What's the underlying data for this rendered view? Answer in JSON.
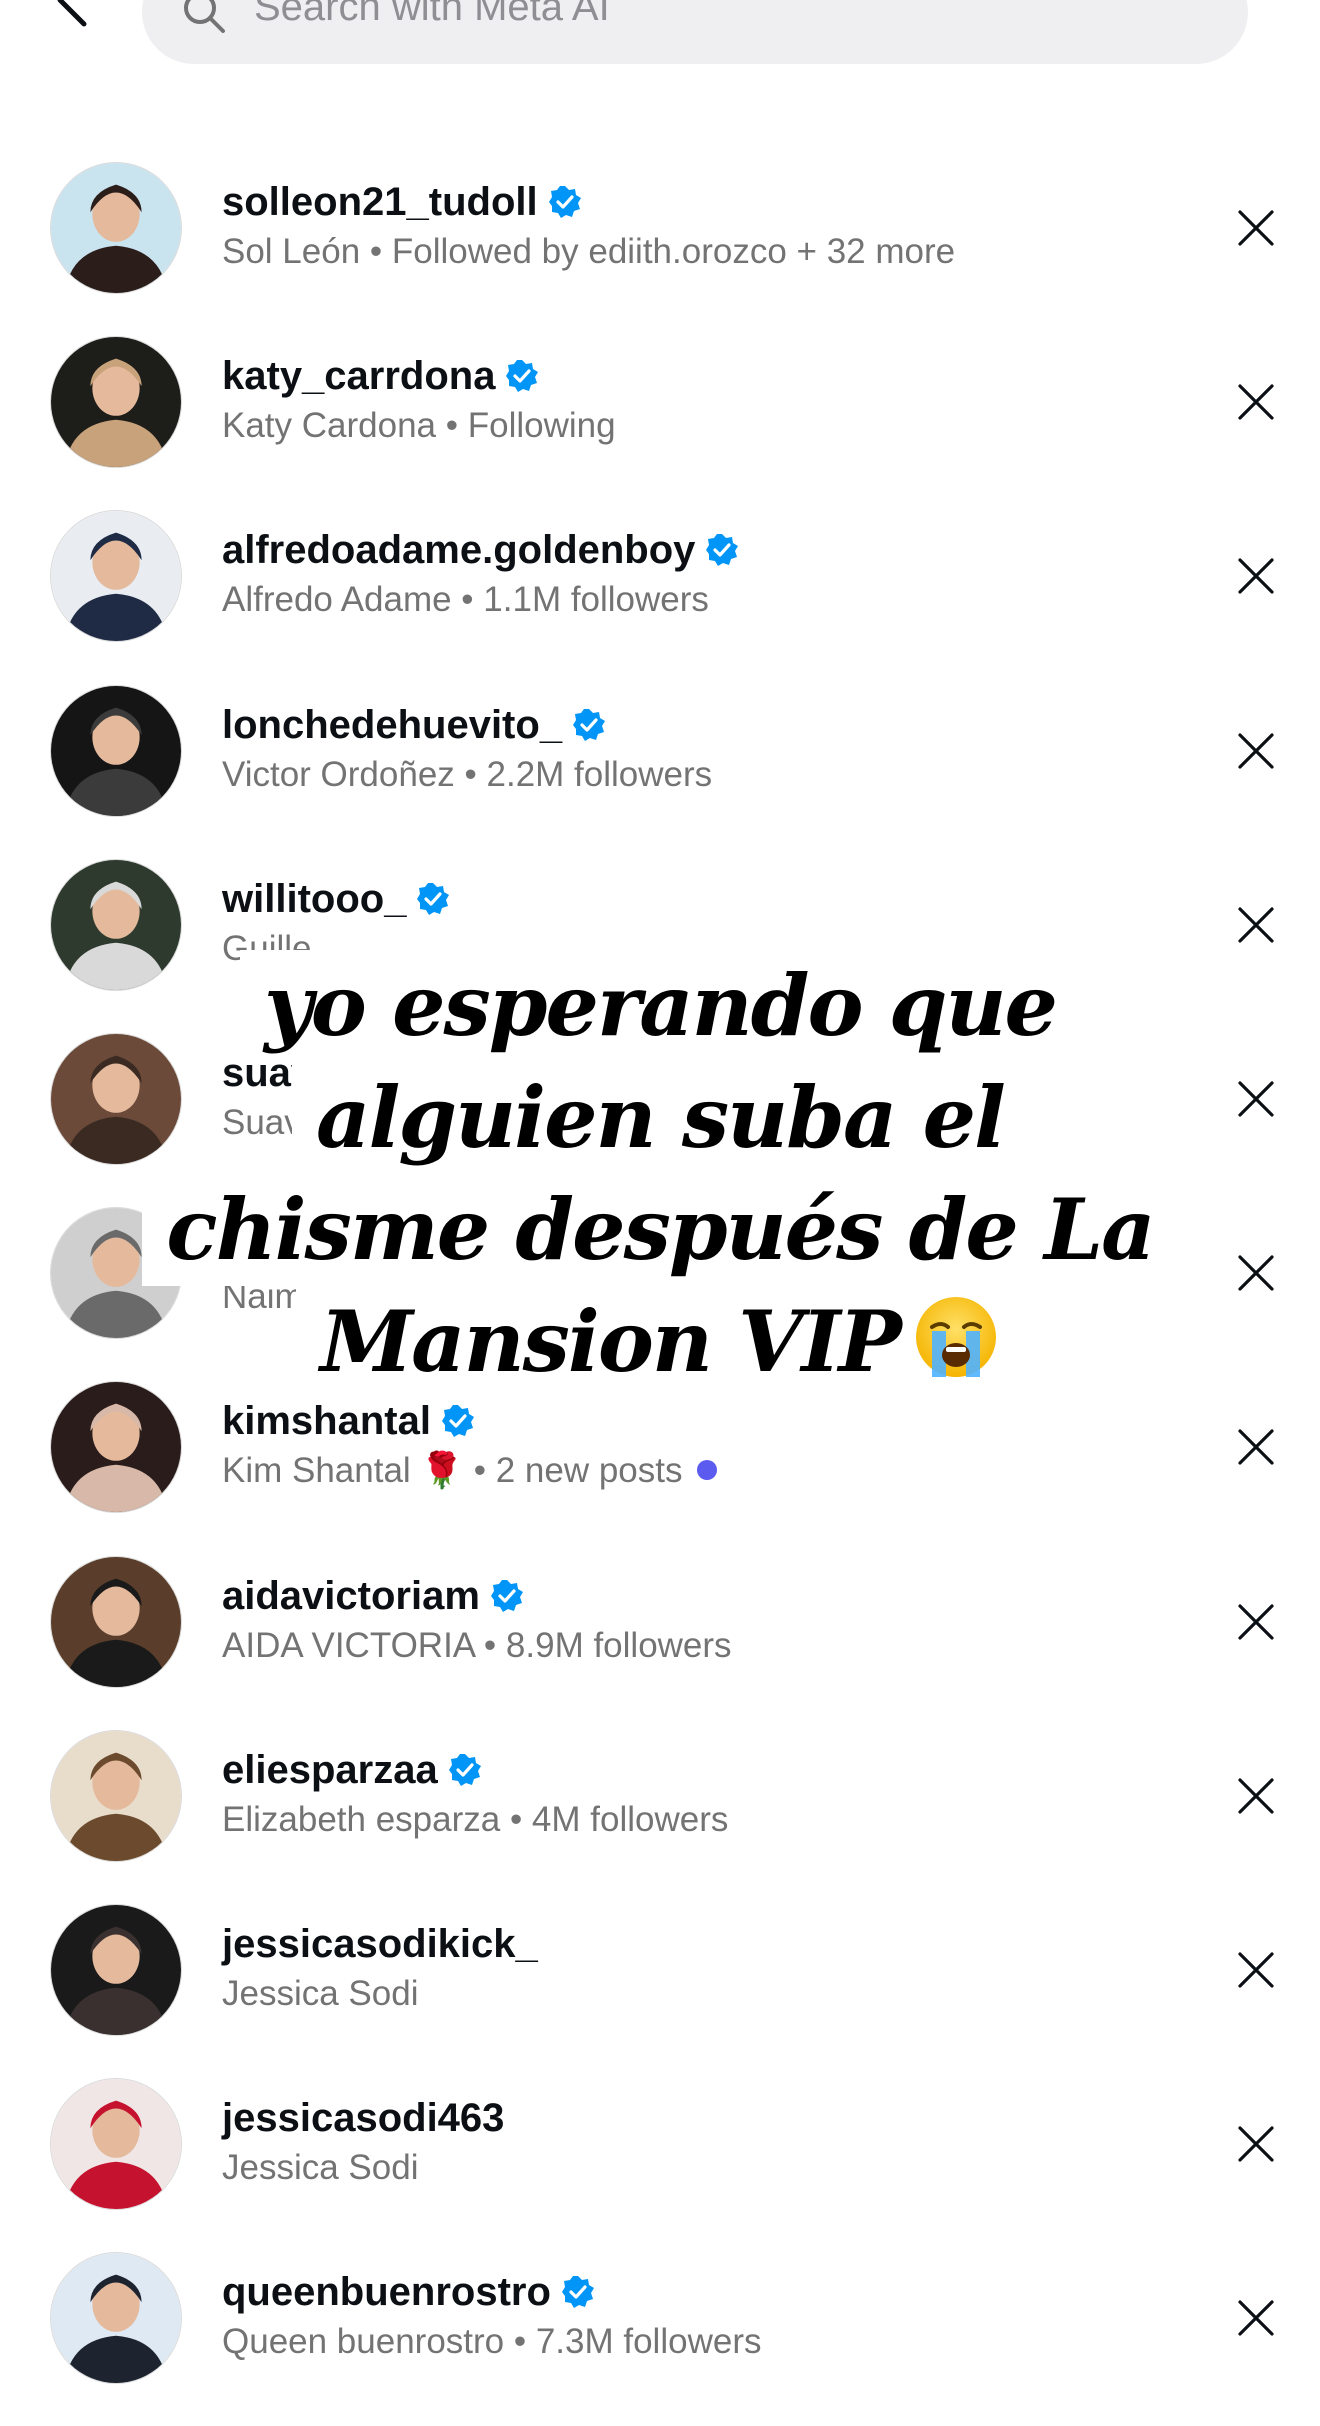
{
  "search": {
    "placeholder": "Search with Meta AI"
  },
  "accounts": [
    {
      "username": "solleon21_tudoll",
      "verified": true,
      "subtitle": "Sol León • Followed by ediith.orozco + 32 more",
      "new_posts_dot": false
    },
    {
      "username": "katy_carrdona",
      "verified": true,
      "subtitle": "Katy  Cardona • Following",
      "new_posts_dot": false
    },
    {
      "username": "alfredoadame.goldenboy",
      "verified": true,
      "subtitle": "Alfredo Adame • 1.1M followers",
      "new_posts_dot": false
    },
    {
      "username": "lonchedehuevito_",
      "verified": true,
      "subtitle": "Victor Ordoñez • 2.2M followers",
      "new_posts_dot": false
    },
    {
      "username": "willitooo_",
      "verified": true,
      "subtitle": "Guille",
      "new_posts_dot": false
    },
    {
      "username": "suavec",
      "verified": false,
      "subtitle": "Suave •",
      "new_posts_dot": false
    },
    {
      "username": "n",
      "verified": false,
      "subtitle": "Naim Al",
      "new_posts_dot": false
    },
    {
      "username": "kimshantal",
      "verified": true,
      "subtitle": "Kim Shantal 🌹 • 2 new posts",
      "new_posts_dot": true
    },
    {
      "username": "aidavictoriam",
      "verified": true,
      "subtitle": "AIDA VICTORIA • 8.9M followers",
      "new_posts_dot": false
    },
    {
      "username": "eliesparzaa",
      "verified": true,
      "subtitle": "Elizabeth esparza • 4M followers",
      "new_posts_dot": false
    },
    {
      "username": "jessicasodikick_",
      "verified": false,
      "subtitle": "Jessica Sodi",
      "new_posts_dot": false
    },
    {
      "username": "jessicasodi463",
      "verified": false,
      "subtitle": "Jessica Sodi",
      "new_posts_dot": false
    },
    {
      "username": "queenbuenrostro",
      "verified": true,
      "subtitle": "Queen buenrostro • 7.3M followers",
      "new_posts_dot": false
    }
  ],
  "caption": {
    "lines": [
      "yo esperando que",
      "alguien suba el",
      "chisme después de La",
      "Mansion VIP"
    ],
    "emoji": "loudly-crying-face-emoji"
  },
  "icons": {
    "back": "back-chevron-icon",
    "search": "search-icon",
    "verified": "verified-badge-icon",
    "remove": "close-icon"
  },
  "colors": {
    "verified_badge": "#0095f6",
    "new_post_dot": "#5b5bf0",
    "secondary_text": "#737373",
    "search_background": "#efeff1"
  }
}
